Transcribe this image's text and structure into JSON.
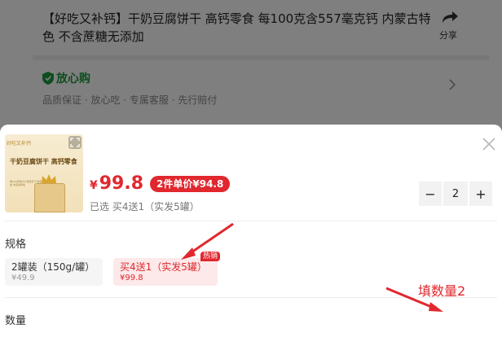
{
  "background": {
    "title": "【好吃又补钙】干奶豆腐饼干 高钙零食 每100克含557毫克钙 内蒙古特色 不含蔗糖无添加",
    "share_label": "分享",
    "assurance": {
      "title": "放心购",
      "items": "品质保证 · 放心吃 · 专属客服 · 先行赔付"
    }
  },
  "sheet": {
    "thumbnail": {
      "tag": "好吃又补钙",
      "line1": "干奶豆腐饼干 高钙零食",
      "fine_print": "每100克含557毫克钙 不含蔗糖无添加 内蒙古特色"
    },
    "price_symbol": "¥",
    "price": "99.8",
    "promo_badge": "2件单价¥94.8",
    "selected_text": "已选  买4送1（实发5罐）",
    "spec_label": "规格",
    "spec_options": [
      {
        "name": "2罐装（150g/罐）",
        "price": "¥49.9",
        "selected": false
      },
      {
        "name": "买4送1（实发5罐）",
        "price": "¥99.8",
        "selected": true,
        "tag": "热销"
      }
    ],
    "quantity_label": "数量",
    "quantity": {
      "minus": "−",
      "value": "2",
      "plus": "+"
    }
  },
  "annotation": {
    "text": "填数量2",
    "color": "#e0282e"
  },
  "colors": {
    "accent": "#e0282e",
    "assure_green": "#1a9b3c"
  }
}
